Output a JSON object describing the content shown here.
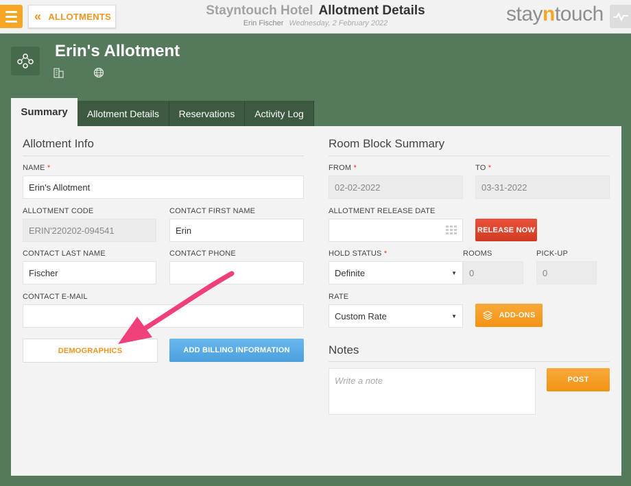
{
  "header": {
    "back_label": "ALLOTMENTS",
    "hotel_name": "Stayntouch Hotel",
    "page_title": "Allotment Details",
    "user_name": "Erin Fischer",
    "date": "Wednesday, 2 February 2022",
    "logo_pre": "stay",
    "logo_n": "n",
    "logo_post": "touch"
  },
  "allotment": {
    "name": "Erin's Allotment"
  },
  "tabs": [
    {
      "label": "Summary",
      "active": true
    },
    {
      "label": "Allotment Details",
      "active": false
    },
    {
      "label": "Reservations",
      "active": false
    },
    {
      "label": "Activity Log",
      "active": false
    }
  ],
  "info": {
    "title": "Allotment Info",
    "name_label": "NAME",
    "name_value": "Erin's Allotment",
    "code_label": "ALLOTMENT CODE",
    "code_value": "ERIN'220202-094541",
    "first_name_label": "CONTACT FIRST NAME",
    "first_name_value": "Erin",
    "last_name_label": "CONTACT LAST NAME",
    "last_name_value": "Fischer",
    "phone_label": "CONTACT PHONE",
    "phone_value": "",
    "email_label": "CONTACT E-MAIL",
    "email_value": "",
    "demographics_label": "DEMOGRAPHICS",
    "billing_label": "ADD BILLING INFORMATION"
  },
  "room_block": {
    "title": "Room Block Summary",
    "from_label": "FROM",
    "from_value": "02-02-2022",
    "to_label": "TO",
    "to_value": "03-31-2022",
    "release_date_label": "ALLOTMENT RELEASE DATE",
    "release_date_value": "",
    "release_now_label": "RELEASE NOW",
    "hold_status_label": "HOLD STATUS",
    "hold_status_value": "Definite",
    "rooms_label": "ROOMS",
    "rooms_value": "0",
    "pickup_label": "PICK-UP",
    "pickup_value": "0",
    "rate_label": "RATE",
    "rate_value": "Custom Rate",
    "addons_label": "ADD-ONS"
  },
  "notes": {
    "title": "Notes",
    "placeholder": "Write a note",
    "post_label": "POST"
  },
  "colors": {
    "accent_orange": "#f6a623",
    "background_green": "#557a5b",
    "release_red": "#d33a22",
    "billing_blue": "#4a9fdc",
    "annotation_pink": "#f0407a"
  }
}
